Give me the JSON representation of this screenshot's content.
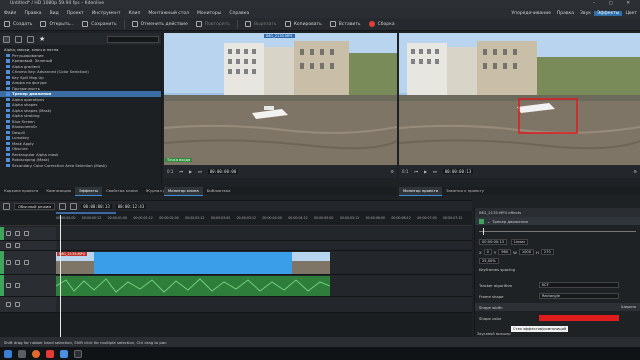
{
  "window": {
    "title": "Untitled* / HD 1080p 59.94 fps – Kdenlive",
    "controls": "– ▢ ✕"
  },
  "menu": {
    "items": [
      "Файл",
      "Правка",
      "Вид",
      "Проект",
      "Инструмент",
      "Клип",
      "Монтажный стол",
      "Мониторы",
      "Справка"
    ],
    "workspaces": [
      "Упорядочивание",
      "Правка",
      "Звук",
      "Эффекты",
      "Цвет"
    ],
    "active_workspace": "Эффекты"
  },
  "toolbar": {
    "new": "Создать",
    "open": "Открыть...",
    "save": "Сохранить",
    "undo": "Отменить действие",
    "redo": "Повторить",
    "cut": "Вырезать",
    "copy": "Копировать",
    "paste": "Вставить",
    "render": "Сборка"
  },
  "effects": {
    "items": [
      {
        "label": "Alpha, маски, ключ и пятнa",
        "type": "cat"
      },
      {
        "label": "Ретуширование",
        "type": "item"
      },
      {
        "label": "Кремовый. Зеленый",
        "type": "item"
      },
      {
        "label": "Alpha gradient",
        "type": "item"
      },
      {
        "label": "Chroma Key: Advanced (Color Selection)",
        "type": "item"
      },
      {
        "label": "Key Spill Mop Up",
        "type": "item"
      },
      {
        "label": "Альфа по фигуре",
        "type": "item"
      },
      {
        "label": "Прозрачность",
        "type": "item"
      },
      {
        "label": "Трекер движения",
        "type": "sel"
      },
      {
        "label": "Alpha operations",
        "type": "item"
      },
      {
        "label": "Alpha shapes",
        "type": "item"
      },
      {
        "label": "Alpha shapes (Mask)",
        "type": "item"
      },
      {
        "label": "Alpha strobing",
        "type": "item"
      },
      {
        "label": "Blue Screen",
        "type": "item"
      },
      {
        "label": "Bluescreen0r",
        "type": "item"
      },
      {
        "label": "Despill",
        "type": "item"
      },
      {
        "label": "Lumakey",
        "type": "item"
      },
      {
        "label": "Mask Apply",
        "type": "item"
      },
      {
        "label": "Obscure",
        "type": "item"
      },
      {
        "label": "Rectangular Alpha mask",
        "type": "item"
      },
      {
        "label": "Rotoscoping (Mask)",
        "type": "item"
      },
      {
        "label": "Secondary Color Correction Area Selection (Mask)",
        "type": "item"
      }
    ],
    "tabs": [
      "Корзина проекта",
      "Композиции",
      "Эффекты",
      "Свойства клипа",
      "Журнал действий"
    ],
    "active_tab": "Эффекты"
  },
  "clip_monitor": {
    "clip_name": "IMG_2135.MP4",
    "overlay_label": "Точка входа",
    "zoom": "0:1",
    "timecode": "00:00:00:00",
    "tabs": [
      "Монитор клипа",
      "Библиотека"
    ]
  },
  "project_monitor": {
    "zoom": "0:1",
    "timecode": "00:00:00:13",
    "tabs": [
      "Монитор проекта",
      "Заметки к проекту"
    ]
  },
  "timeline": {
    "mode_label": "Обычный режим",
    "position_tc": "00:00:00:13",
    "duration_tc": "00:00:12:43",
    "ruler_ticks": [
      "00:00:00:00",
      "00:00:00:12",
      "00:00:01:00",
      "00:00:01:12",
      "00:00:02:00",
      "00:00:02:12",
      "00:00:03:00",
      "00:00:03:12",
      "00:00:04:00",
      "00:00:04:12",
      "00:00:05:00",
      "00:00:05:12",
      "00:00:06:00",
      "00:00:06:12",
      "00:00:07:00",
      "00:00:07:12"
    ],
    "clip_label": "IMG_2135.MP4"
  },
  "effect_stack": {
    "clip_title": "IMG_2135.MP4 effects",
    "effect_name": "Трекер движения",
    "timecode": "00:00:00:13",
    "interp": "Linear",
    "rect": {
      "x": "0",
      "y": "960",
      "w": "1000",
      "h": "270"
    },
    "opacity": "25,00%",
    "keyframe_label": "Keyframes spacing",
    "tracker_label": "Tracker algorithm",
    "tracker_value": "KCF",
    "frame_label": "Frame shape",
    "frame_value": "Rectangle",
    "shape_width_label": "Shape width",
    "shape_width_value": "Ширина",
    "shape_color_label": "Shape color",
    "shape_color": "#e01b1b",
    "tooltip": "Стек эффектов/композиций",
    "bottom_label": "Звуковой микшер"
  },
  "status": {
    "hint": "Shift drag for rubber band selection, Shift click for multiple selection, Ctrl drag to pan"
  },
  "colors": {
    "accent": "#2d6fa8",
    "clip_video": "#3a9ee8",
    "clip_audio": "#2e7d3b",
    "track_green": "#3fa45c",
    "tracker_box": "#e01b1b"
  }
}
